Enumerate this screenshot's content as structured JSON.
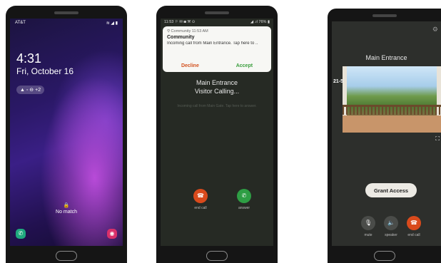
{
  "lock_screen": {
    "carrier": "AT&T",
    "status_icons": "≋ ◢ ▮",
    "time": "4:31",
    "date": "Fri, October 16",
    "notification_pill": "▲ ◦ ⊖ +2",
    "lock_icon": "🔒",
    "biometric_message": "No match",
    "shortcut_left_icon": "phone-icon",
    "shortcut_right_icon": "camera-icon"
  },
  "incoming_call": {
    "status_left": "11:53 ⚐ ✉ ◙ ⚒ ⊙",
    "status_right": "◢ .ıl 76% ▮",
    "notification": {
      "app_line": "⚲ Community  11:53 AM",
      "title": "Community",
      "body": "Incoming call from Main Entrance. Tap here to ..",
      "decline_label": "Decline",
      "accept_label": "Accept"
    },
    "caller": "Main Entrance",
    "call_state": "Visitor Calling...",
    "hint": "Incoming call from Main Gate. Tap here to answer.",
    "end_call_label": "end call",
    "answer_label": "answer"
  },
  "video_call": {
    "title": "Main Entrance",
    "timestamp": "21-5",
    "grant_access_label": "Grant Access",
    "mute_label": "mute",
    "speaker_label": "speaker",
    "end_call_label": "end call"
  },
  "colors": {
    "decline": "#d3521f",
    "accept": "#3a9e3d",
    "end_call": "#d94a1c",
    "answer": "#2e9e44"
  }
}
